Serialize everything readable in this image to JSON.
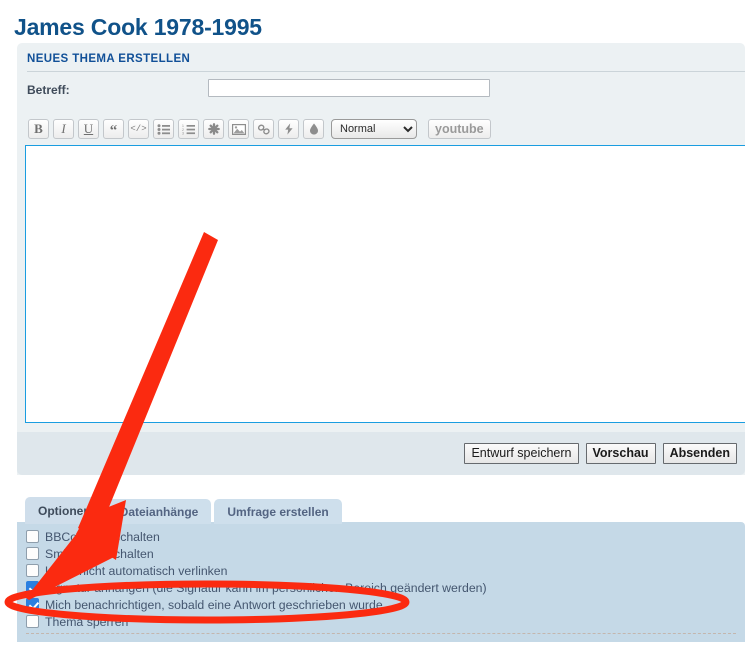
{
  "page": {
    "title": "James Cook 1978-1995"
  },
  "post_panel": {
    "heading": "NEUES THEMA ERSTELLEN",
    "subject": {
      "label": "Betreff:",
      "value": "",
      "placeholder": ""
    },
    "message": {
      "value": "",
      "placeholder": ""
    }
  },
  "toolbar": {
    "buttons": [
      {
        "name": "bold-icon",
        "glyph": "B",
        "title": "Fett"
      },
      {
        "name": "italic-icon",
        "glyph": "I",
        "title": "Kursiv"
      },
      {
        "name": "underline-icon",
        "glyph": "U",
        "title": "Unterstrichen"
      },
      {
        "name": "quote-icon",
        "glyph": "“",
        "title": "Zitat"
      },
      {
        "name": "code-icon",
        "glyph": "</>",
        "title": "Code"
      },
      {
        "name": "unordered-list-icon",
        "glyph": "",
        "title": "Liste"
      },
      {
        "name": "ordered-list-icon",
        "glyph": "",
        "title": "Nummerierte Liste"
      },
      {
        "name": "smiley-asterisk-icon",
        "glyph": "✱",
        "title": "Smilies"
      },
      {
        "name": "image-icon",
        "glyph": "",
        "title": "Bild"
      },
      {
        "name": "link-icon",
        "glyph": "",
        "title": "Link"
      },
      {
        "name": "flash-icon",
        "glyph": "",
        "title": "Flash"
      },
      {
        "name": "color-droplet-icon",
        "glyph": "",
        "title": "Schriftfarbe"
      }
    ],
    "format_select": {
      "selected": "Normal",
      "options": [
        "Normal"
      ]
    },
    "youtube_label": "youtube"
  },
  "actions": {
    "save_draft_label": "Entwurf speichern",
    "preview_label": "Vorschau",
    "submit_label": "Absenden"
  },
  "tabs": [
    {
      "label": "Optionen",
      "active": true
    },
    {
      "label": "Dateianhänge",
      "active": false
    },
    {
      "label": "Umfrage erstellen",
      "active": false
    }
  ],
  "options": [
    {
      "label": "BBCode ausschalten",
      "checked": false
    },
    {
      "label": "Smilies ausschalten",
      "checked": false
    },
    {
      "label": "URLs nicht automatisch verlinken",
      "checked": false
    },
    {
      "label": "Signatur anhängen (die Signatur kann im persönlichen Bereich geändert werden)",
      "checked": true
    },
    {
      "label": "Mich benachrichtigen, sobald eine Antwort geschrieben wurde",
      "checked": true
    },
    {
      "label": "Thema sperren",
      "checked": false
    }
  ],
  "annotation": {
    "arrow_color": "#fb2a10",
    "highlight_color": "#fb2a10",
    "target_option_index": 4
  },
  "colors": {
    "title": "#105289",
    "panel_bg": "#ecf1f3",
    "action_bar_bg": "#dfe7ec",
    "options_bg": "#c5d9e7",
    "focus_border": "#1a9de0",
    "accent": "#2b7fe0"
  }
}
